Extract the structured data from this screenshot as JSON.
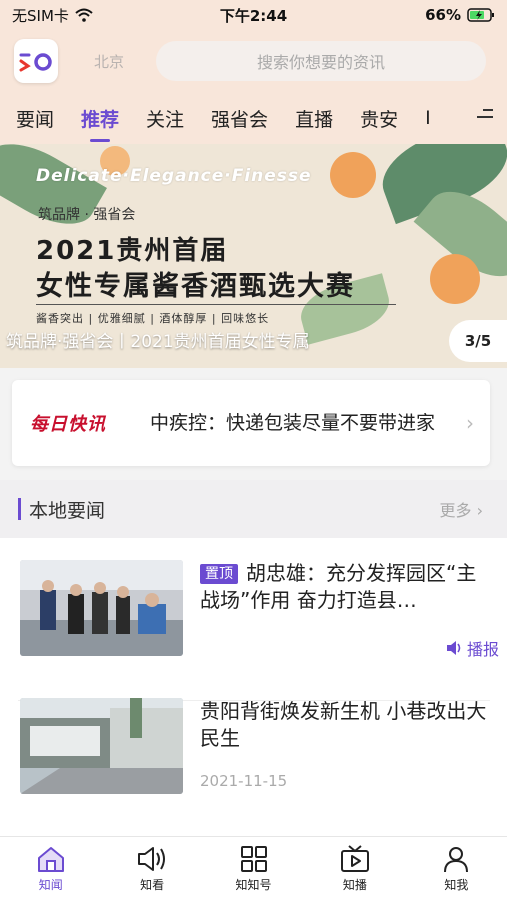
{
  "status_bar": {
    "carrier": "无SIM卡",
    "time": "下午2:44",
    "battery": "66%"
  },
  "header": {
    "city": "北京",
    "search_placeholder": "搜索你想要的资讯"
  },
  "tabs": [
    {
      "label": "要闻"
    },
    {
      "label": "推荐",
      "active": true
    },
    {
      "label": "关注"
    },
    {
      "label": "强省会"
    },
    {
      "label": "直播"
    },
    {
      "label": "贵安"
    },
    {
      "label": "I"
    }
  ],
  "banner": {
    "brand_line": "Delicate·Elegance·Finesse",
    "subtitle": "筑品牌 · 强省会",
    "title_line1": "2021贵州首届",
    "title_line2": "女性专属酱香酒甄选大赛",
    "tags": "酱香突出 | 优雅细腻 | 酒体醇厚 | 回味悠长",
    "caption": "筑品牌·强省会丨2021贵州首届女性专属",
    "pager": "3/5"
  },
  "flash_news": {
    "badge": "每日快讯",
    "headline": "中疾控：快递包装尽量不要带进家"
  },
  "local_news": {
    "title": "本地要闻",
    "more": "更多",
    "items": [
      {
        "pin": "置顶",
        "title": "胡忠雄：充分发挥园区“主战场”作用 奋力打造县…",
        "listen": "播报"
      },
      {
        "title": "贵阳背街焕发新生机 小巷改出大民生",
        "date": "2021-11-15"
      }
    ]
  },
  "bottom_nav": [
    {
      "label": "知闻",
      "icon": "home-icon",
      "active": true
    },
    {
      "label": "知看",
      "icon": "speaker-icon"
    },
    {
      "label": "知知号",
      "icon": "grid-icon"
    },
    {
      "label": "知播",
      "icon": "tv-icon"
    },
    {
      "label": "知我",
      "icon": "person-icon"
    }
  ],
  "colors": {
    "accent": "#6b4bd1",
    "header_bg": "#f8e6da",
    "flash_red": "#c8102e"
  }
}
